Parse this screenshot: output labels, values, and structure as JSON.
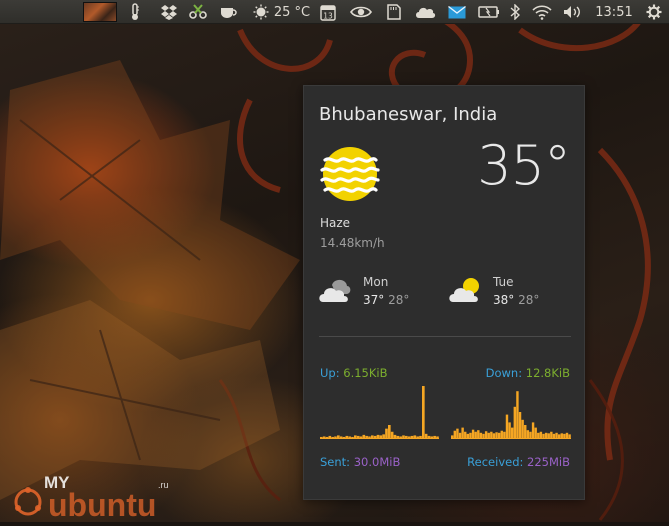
{
  "panel": {
    "temperature": "25 °C",
    "calendar_day": "13",
    "clock": "13:51",
    "icons": [
      "window-thumbnail",
      "thermometer-icon",
      "dropbox-icon",
      "scissors-icon",
      "coffee-cup-icon",
      "sun-icon",
      "calendar-icon",
      "eye-icon",
      "memory-card-icon",
      "cloud-icon",
      "mail-icon",
      "battery-icon",
      "bluetooth-icon",
      "wifi-icon",
      "volume-icon",
      "session-gear-icon"
    ]
  },
  "weather": {
    "location": "Bhubaneswar, India",
    "temperature": "35°",
    "condition": "Haze",
    "wind": "14.48km/h",
    "current_icon": "haze-icon",
    "forecast": [
      {
        "day": "Mon",
        "high": "37°",
        "low": "28°",
        "icon": "partly-cloudy-icon"
      },
      {
        "day": "Tue",
        "high": "38°",
        "low": "28°",
        "icon": "partly-sunny-icon"
      }
    ]
  },
  "network": {
    "up_label": "Up:",
    "up_value": "6.15KiB",
    "down_label": "Down:",
    "down_value": "12.8KiB",
    "sent_label": "Sent:",
    "sent_value": "30.0MiB",
    "received_label": "Received:",
    "received_value": "225MiB",
    "upload_history": [
      0.02,
      0.03,
      0.02,
      0.04,
      0.02,
      0.03,
      0.05,
      0.03,
      0.02,
      0.04,
      0.03,
      0.02,
      0.05,
      0.04,
      0.03,
      0.06,
      0.04,
      0.03,
      0.05,
      0.04,
      0.06,
      0.05,
      0.07,
      0.18,
      0.25,
      0.12,
      0.06,
      0.04,
      0.03,
      0.05,
      0.04,
      0.03,
      0.04,
      0.05,
      0.03,
      0.04,
      1.0,
      0.08,
      0.04,
      0.03,
      0.04,
      0.03
    ],
    "download_history": [
      0.05,
      0.14,
      0.18,
      0.1,
      0.2,
      0.12,
      0.08,
      0.1,
      0.16,
      0.12,
      0.15,
      0.1,
      0.08,
      0.13,
      0.1,
      0.12,
      0.09,
      0.11,
      0.1,
      0.14,
      0.12,
      0.45,
      0.3,
      0.2,
      0.6,
      0.9,
      0.5,
      0.35,
      0.25,
      0.15,
      0.12,
      0.3,
      0.2,
      0.1,
      0.12,
      0.08,
      0.1,
      0.09,
      0.12,
      0.08,
      0.1,
      0.07,
      0.09,
      0.08,
      0.1,
      0.07
    ],
    "graph_color": "#f5a623"
  },
  "watermark": {
    "text_my": "MY",
    "text_ubuntu": "ubuntu",
    "text_ru": ".ru"
  }
}
